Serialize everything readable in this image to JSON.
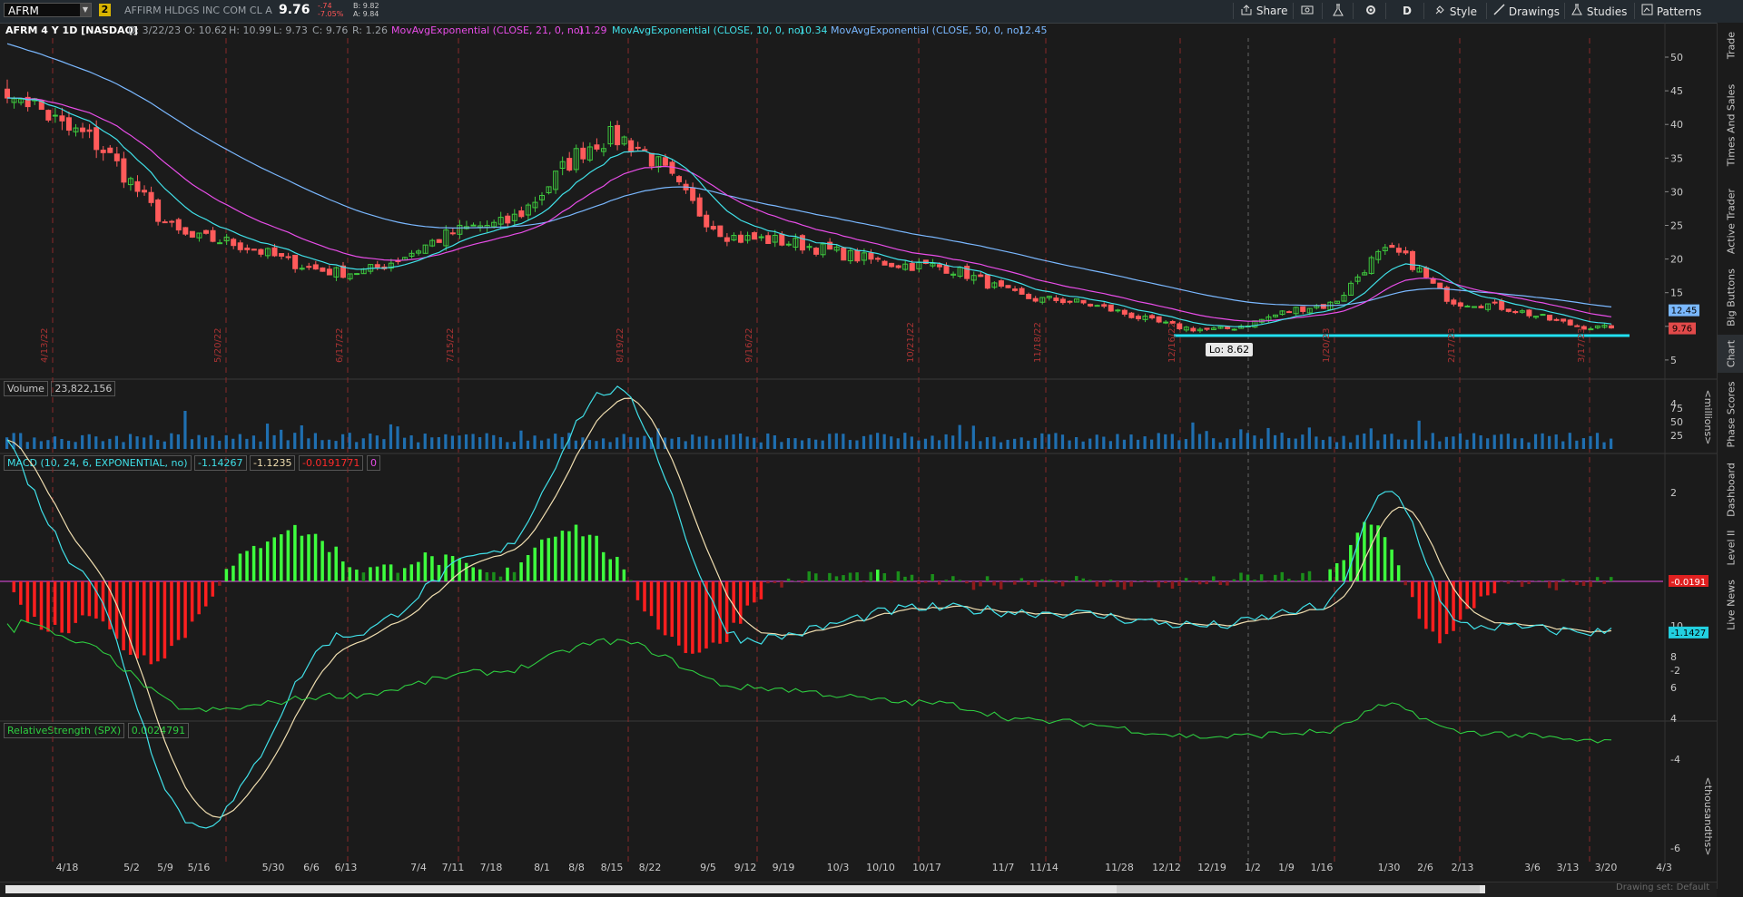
{
  "header": {
    "symbol": "AFRM",
    "linked_badge": "2",
    "company": "AFFIRM HLDGS INC COM CL A",
    "last": "9.76",
    "change": "-.74",
    "change_pct": "-7.05%",
    "bid": "B: 9.82",
    "ask": "A: 9.84",
    "buttons": {
      "share": "Share",
      "period": "D",
      "style": "Style",
      "drawings": "Drawings",
      "studies": "Studies",
      "patterns": "Patterns"
    }
  },
  "infobar": {
    "title": "AFRM 4 Y 1D [NASDAQ]",
    "date": "D: 3/22/23",
    "open": "O: 10.62",
    "high": "H: 10.99",
    "low": "L: 9.73",
    "close": "C: 9.76",
    "range": "R: 1.26",
    "ema21_label": "MovAvgExponential (CLOSE, 21, 0, no)",
    "ema21_value": "11.29",
    "ema10_label": "MovAvgExponential (CLOSE, 10, 0, no)",
    "ema10_value": "10.34",
    "ema50_label": "MovAvgExponential (CLOSE, 50, 0, no)",
    "ema50_value": "12.45",
    "colors": {
      "ema21": "#e84de8",
      "ema10": "#40e0e8",
      "ema50": "#7ab8ff"
    }
  },
  "price_panel": {
    "y_ticks": [
      "50",
      "45",
      "40",
      "35",
      "30",
      "25",
      "20",
      "15",
      "10",
      "5"
    ],
    "last_label": "9.76",
    "ema50_label": "12.45",
    "low_annotation": "Lo: 8.62",
    "support_line_level": 8.62,
    "event_dates": [
      "4/13/22",
      "5/20/22",
      "6/17/22",
      "7/15/22",
      "8/19/22",
      "9/16/22",
      "10/21/22",
      "11/18/22",
      "12/16/22",
      "1/20/23",
      "2/17/23",
      "3/17/23"
    ]
  },
  "volume_panel": {
    "label": "Volume",
    "value": "23,822,156",
    "y_ticks": [
      "75",
      "50",
      "25"
    ],
    "units": "<millions>"
  },
  "macd_panel": {
    "label": "MACD (10, 24, 6, EXPONENTIAL, no)",
    "value": "-1.14267",
    "avg": "-1.1235",
    "diff": "-0.0191771",
    "zero": "0",
    "y_ticks": [
      "4",
      "2",
      "-2",
      "-4",
      "-6"
    ],
    "diff_label": "-0.0191",
    "value_label": "-1.1427"
  },
  "rs_panel": {
    "label": "RelativeStrength (SPX)",
    "value": "0.0024791",
    "y_ticks": [
      "10",
      "8",
      "6",
      "4"
    ],
    "units": "<thousandths>"
  },
  "x_axis": {
    "labels": [
      "4/18",
      "5/2",
      "5/9",
      "5/16",
      "5/30",
      "6/6",
      "6/13",
      "7/4",
      "7/11",
      "7/18",
      "8/1",
      "8/8",
      "8/15",
      "8/22",
      "9/5",
      "9/12",
      "9/19",
      "10/3",
      "10/10",
      "10/17",
      "11/7",
      "11/14",
      "11/28",
      "12/12",
      "12/19",
      "1/2",
      "1/9",
      "1/16",
      "1/30",
      "2/6",
      "2/13",
      "3/6",
      "3/13",
      "3/20",
      "4/3"
    ]
  },
  "side_tabs": [
    "Trade",
    "Times And Sales",
    "Active Trader",
    "Big Buttons",
    "Chart",
    "Phase Scores",
    "Dashboard",
    "Level II",
    "Live News"
  ],
  "footer": {
    "drawing_set": "Drawing set: Default"
  },
  "chart_data": {
    "type": "candlestick",
    "x": [
      "4/18",
      "5/16",
      "6/13",
      "7/18",
      "8/15",
      "9/12",
      "10/17",
      "11/14",
      "12/19",
      "1/16",
      "1/30",
      "2/13",
      "3/20"
    ],
    "close_approx": [
      39,
      23,
      18,
      25,
      38,
      23,
      19,
      14,
      9.5,
      13,
      21,
      13.5,
      9.76
    ],
    "macd_approx": [
      0.5,
      -5.5,
      -1.2,
      0.6,
      4.3,
      -1.3,
      -0.6,
      -0.7,
      -1.0,
      -0.6,
      2.0,
      -1.0,
      -1.14
    ],
    "relative_strength_approx": [
      9.0,
      4.5,
      5.5,
      7.0,
      9.0,
      6.0,
      5.0,
      3.8,
      2.8,
      3.1,
      4.8,
      3.1,
      2.5
    ]
  }
}
